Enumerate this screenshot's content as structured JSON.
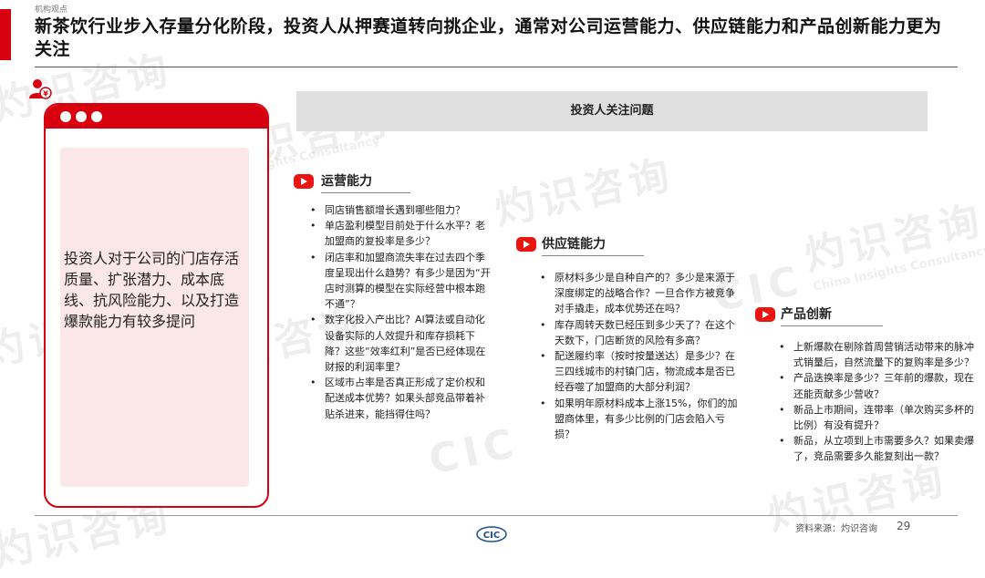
{
  "header": {
    "category": "机构观点",
    "title": "新茶饮行业步入存量分化阶段，投资人从押赛道转向挑企业，通常对公司运营能力、供应链能力和产品创新能力更为关注"
  },
  "watermark": {
    "cn": "灼识咨询",
    "en": "China Insights Consultancy",
    "mark": "CIC"
  },
  "left_card": {
    "text": "投资人对于公司的门店存活质量、扩张潜力、成本底线、抗风险能力、以及打造爆款能力有较多提问"
  },
  "questions_header": "投资人关注问题",
  "sections": [
    {
      "title": "运营能力",
      "items": [
        "同店销售额增长遇到哪些阻力？",
        "单店盈利模型目前处于什么水平？老加盟商的复投率是多少？",
        "闭店率和加盟商流失率在过去四个季度呈现出什么趋势？有多少是因为“开店时测算的模型在实际经营中根本跑不通”？",
        "数字化投入产出比？AI算法或自动化设备实际的人效提升和库存损耗下降？这些“效率红利”是否已经体现在财报的利润率里？",
        "区域市占率是否真正形成了定价权和配送成本优势？如果头部竞品带着补贴杀进来，能挡得住吗？"
      ]
    },
    {
      "title": "供应链能力",
      "items": [
        "原材料多少是自种自产的？多少是来源于深度绑定的战略合作？一旦合作方被竞争对手撬走，成本优势还在吗？",
        "库存周转天数已经压到多少天了？在这个天数下，门店断货的风险有多高？",
        "配送履约率（按时按量送达）是多少？在三四线城市的村镇门店，物流成本是否已经吞噬了加盟商的大部分利润？",
        "如果明年原材料成本上涨15%，你们的加盟商体里，有多少比例的门店会陷入亏损？"
      ]
    },
    {
      "title": "产品创新",
      "items": [
        "上新爆款在剔除首周营销活动带来的脉冲式销量后，自然流量下的复购率是多少？",
        "产品迭换率是多少？三年前的爆款，现在还能贡献多少营收？",
        "新品上市期间，连带率（单次购买多杯的比例）有没有提升？",
        "新品，从立项到上市需要多久？如果卖爆了，竞品需要多久能复刻出一款？"
      ]
    }
  ],
  "footer": {
    "source": "资料来源：灼识咨询",
    "page": "29",
    "logo": "CIC"
  },
  "colors": {
    "accent": "#d7000f",
    "card_fill": "#fbe7e7",
    "header_box": "#e0e0e0"
  },
  "icons": [
    "person-icon",
    "play-icon"
  ]
}
